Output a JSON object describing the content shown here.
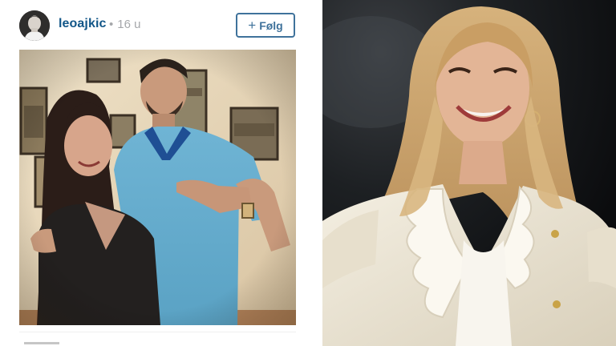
{
  "post": {
    "username": "leoajkic",
    "separator": "•",
    "timestamp": "16 u",
    "follow_label": "Følg",
    "follow_icon": "plus-icon"
  },
  "colors": {
    "username": "#125688",
    "follow_border": "#3f729b",
    "timestamp": "#a5a7aa"
  }
}
